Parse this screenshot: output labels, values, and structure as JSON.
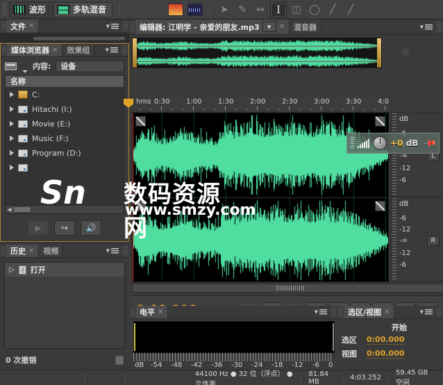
{
  "toolbar": {
    "mode_waveform": "波形",
    "mode_multitrack": "多轨混音",
    "icon_spectral_freq": "spectral-frequency-icon",
    "icon_spectral_pan": "spectral-pan-icon",
    "tools": [
      {
        "name": "move-tool",
        "glyph": "➤"
      },
      {
        "name": "slip-tool",
        "glyph": "✒"
      },
      {
        "name": "time-selection-tool",
        "glyph": "↔"
      },
      {
        "name": "razor-tool",
        "glyph": "I"
      },
      {
        "name": "marquee-tool",
        "glyph": "⬚"
      },
      {
        "name": "lasso-tool",
        "glyph": "◯"
      },
      {
        "name": "paintbrush-tool",
        "glyph": "╱"
      },
      {
        "name": "eraser-tool",
        "glyph": "╱"
      }
    ]
  },
  "file_panel": {
    "tab": "文件"
  },
  "media_browser": {
    "tab": "媒体浏览器",
    "tab2": "效果组",
    "content_label": "内容:",
    "content_value": "设备",
    "column_header": "名称",
    "items": [
      {
        "label": "C:",
        "icon": "computer-icon"
      },
      {
        "label": "Hitachi (I:)",
        "icon": "drive-icon"
      },
      {
        "label": "Movie (E:)",
        "icon": "drive-icon"
      },
      {
        "label": "Music (F:)",
        "icon": "drive-icon"
      },
      {
        "label": "Program (D:)",
        "icon": "drive-icon"
      },
      {
        "label": "",
        "icon": "drive-icon"
      }
    ],
    "buttons": [
      {
        "name": "play-button",
        "glyph": "▶"
      },
      {
        "name": "import-button",
        "glyph": "↪"
      },
      {
        "name": "auto-play-button",
        "glyph": "◀"
      }
    ]
  },
  "history_panel": {
    "tab": "历史",
    "tab2": "视频",
    "entry": "打开",
    "undo_count": "0 次撤销",
    "trash_icon": "trash-icon"
  },
  "editor": {
    "tab": "编辑器: 江明学 - 亲爱的朋友.mp3",
    "tab_mixer": "混音器",
    "ruler_unit": "hms",
    "ruler_ticks": [
      "0:30",
      "1:00",
      "1:30",
      "2:00",
      "2:30",
      "3:00",
      "3:30",
      "4:0"
    ],
    "db_label": "dB",
    "db_ticks_upper": [
      "-6",
      "-12",
      "-∞",
      "-12",
      "-6"
    ],
    "db_ticks_lower": [
      "-6",
      "-12",
      "-∞",
      "-12",
      "-6"
    ],
    "channel_left": "L",
    "channel_right": "R",
    "snap_icon": "magnet-snap-icon",
    "hud": {
      "gain": "+0",
      "unit": "dB",
      "pin_icon": "pin-icon",
      "knob_icon": "gain-knob-icon"
    },
    "time_display": "0:00.000",
    "transport": [
      {
        "name": "stop-button",
        "glyph": "■"
      },
      {
        "name": "play-button",
        "glyph": "▶"
      },
      {
        "name": "pause-button",
        "glyph": "⏸"
      },
      {
        "name": "skip-start-button",
        "glyph": "⏮"
      },
      {
        "name": "rewind-button",
        "glyph": "⏪"
      },
      {
        "name": "fast-forward-button",
        "glyph": "⏩"
      },
      {
        "name": "skip-end-button",
        "glyph": "⏭"
      },
      {
        "name": "record-button",
        "glyph": "●"
      },
      {
        "name": "loop-button",
        "glyph": "↻"
      }
    ]
  },
  "level_panel": {
    "tab": "电平",
    "db_label": "dB",
    "scale": [
      "-54",
      "-48",
      "-42",
      "-36",
      "-30",
      "-24",
      "-18",
      "-12",
      "-6",
      "0"
    ]
  },
  "selection_panel": {
    "tab": "选区/视图",
    "col_start": "开始",
    "rows": [
      {
        "key": "选区",
        "value": "0:00.000"
      },
      {
        "key": "视图",
        "value": "0:00.000"
      }
    ]
  },
  "status_bar": {
    "format": "44100 Hz ● 32 位（浮点） ● 立体声",
    "size": "81.84 MB",
    "duration": "4:03.252",
    "free_space": "59.45 GB 空闲"
  },
  "watermark": {
    "logo": "Sn",
    "name": "数码资源网",
    "url": "www.smzy.com"
  },
  "colors": {
    "accent_amber": "#e0a32b",
    "waveform_green": "#4fdda0",
    "panel_bg": "#3a3a3a",
    "golden_border": "#a8802c"
  }
}
